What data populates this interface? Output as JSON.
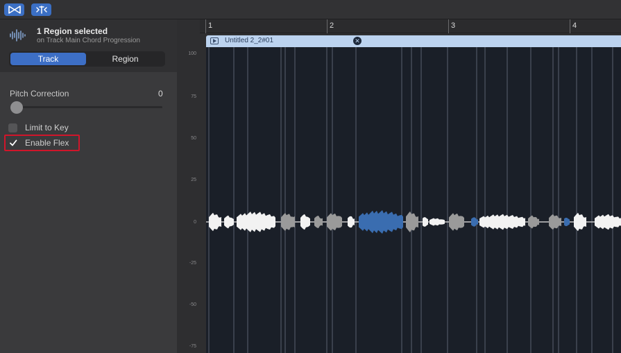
{
  "toolbar": {
    "buttons": [
      {
        "name": "bowtie-icon"
      },
      {
        "name": "flex-tool-icon"
      }
    ]
  },
  "inspector": {
    "title": "1 Region selected",
    "subtitle": "on Track Main Chord Progression",
    "tabs": [
      {
        "label": "Track",
        "active": true
      },
      {
        "label": "Region",
        "active": false
      }
    ],
    "pitch_correction": {
      "label": "Pitch Correction",
      "value": "0",
      "level": 0
    },
    "limit_to_key": {
      "label": "Limit to Key",
      "checked": false
    },
    "enable_flex": {
      "label": "Enable Flex",
      "checked": true
    }
  },
  "ruler": {
    "bars": [
      "1",
      "2",
      "3",
      "4"
    ]
  },
  "region": {
    "name": "Untitled 2_2#01"
  },
  "y_axis": {
    "labels": [
      "100",
      "75",
      "50",
      "25",
      "0",
      "-25",
      "-50",
      "-75"
    ]
  },
  "colors": {
    "accent": "#3d6fc6",
    "highlight": "#d1152a",
    "region_header": "#bcd3ef",
    "waveform_white": "#f2f2f2",
    "waveform_gray": "#9a9a9a",
    "waveform_blue": "#3a6db0",
    "editor_bg": "#1a1f28"
  }
}
